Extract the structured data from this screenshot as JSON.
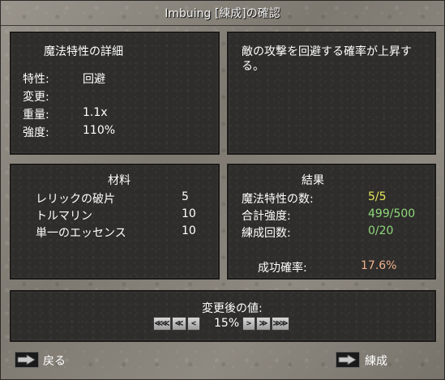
{
  "window": {
    "title": "Imbuing [練成]の確認"
  },
  "details": {
    "heading": "魔法特性の詳細",
    "rows": [
      {
        "label": "特性:",
        "value": "回避"
      },
      {
        "label": "変更:",
        "value": ""
      },
      {
        "label": "重量:",
        "value": "1.1x"
      },
      {
        "label": "強度:",
        "value": "110%"
      }
    ]
  },
  "description": {
    "text": "敵の攻撃を回避する確率が上昇する。"
  },
  "materials": {
    "heading": "材料",
    "items": [
      {
        "name": "レリックの破片",
        "qty": "5"
      },
      {
        "name": "トルマリン",
        "qty": "10"
      },
      {
        "name": "単一のエッセンス",
        "qty": "10"
      }
    ]
  },
  "results": {
    "heading": "結果",
    "rows": [
      {
        "label": "魔法特性の数:",
        "value": "5/5"
      },
      {
        "label": "合計強度:",
        "value": "499/500"
      },
      {
        "label": "練成回数:",
        "value": "0/20"
      }
    ],
    "success_label": "成功確率:",
    "success_value": "17.6%"
  },
  "adjust": {
    "heading": "変更後の値:",
    "value": "15%",
    "buttons": [
      "≪≪",
      "≪",
      "<",
      ">",
      "≫",
      "≫≫"
    ]
  },
  "footer": {
    "back_label": "戻る",
    "imbue_label": "練成"
  },
  "colors": {
    "yellow": "#e8e85a",
    "green": "#8fd87a",
    "salmon": "#f0b08a"
  }
}
